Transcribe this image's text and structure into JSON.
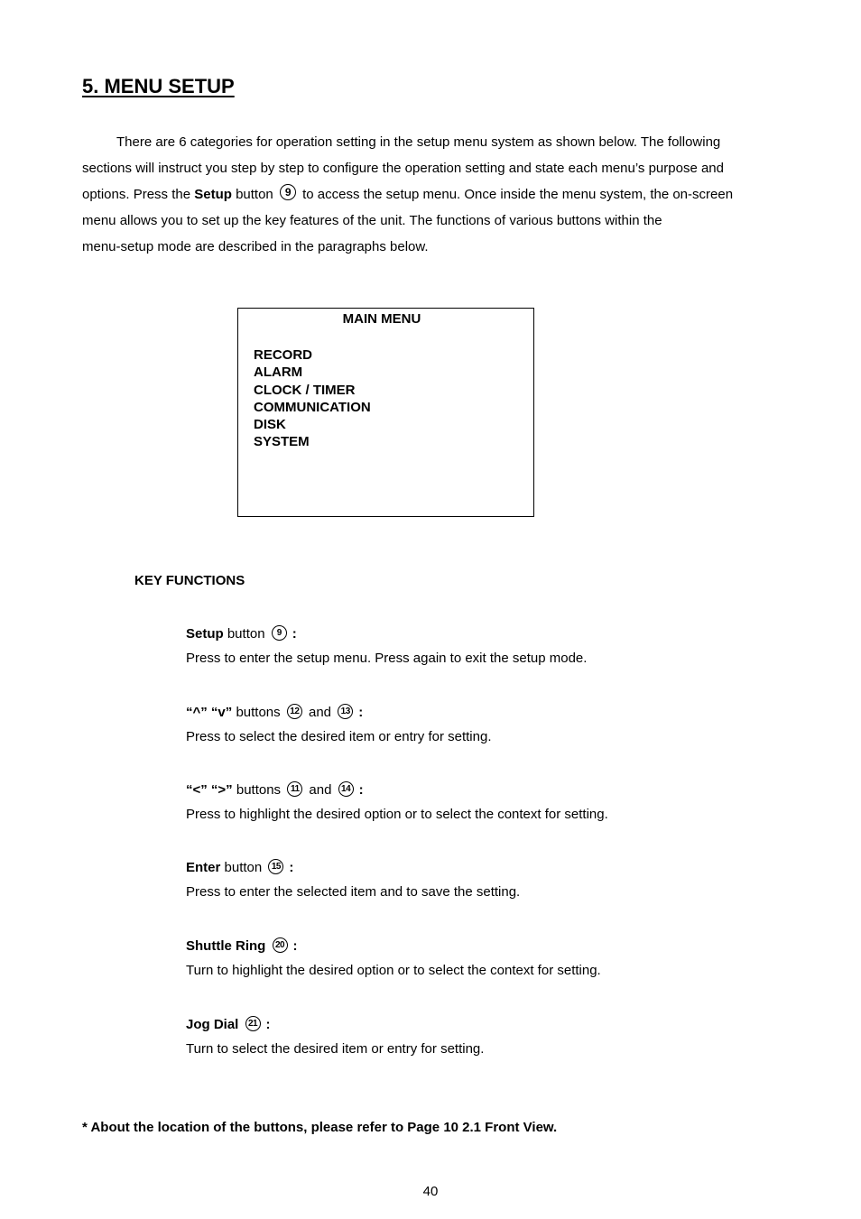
{
  "section_title": "5. MENU SETUP",
  "intro": {
    "line1": "There are 6 categories for operation setting in the setup menu system as shown below. The following",
    "line2": "sections will instruct you step by step to configure the operation setting and state each menu’s purpose and",
    "line3_pre": "options. Press the ",
    "line3_bold": "Setup",
    "line3_mid": " button ",
    "line3_ref": "9",
    "line3_post": " to access the setup menu. Once inside the menu system, the on-screen",
    "line4": "menu allows you to set up the key features of the unit. The functions of various buttons within the",
    "line5": "menu-setup mode are described in the paragraphs below."
  },
  "main_menu": {
    "title": "MAIN MENU",
    "items": [
      "RECORD",
      "ALARM",
      "CLOCK / TIMER",
      "COMMUNICATION",
      "DISK",
      "SYSTEM"
    ]
  },
  "key_functions": {
    "heading": "KEY FUNCTIONS",
    "items": [
      {
        "bold": "Setup",
        "label": " button",
        "refs": [
          "9"
        ],
        "joiner": "",
        "desc": "Press to enter the setup menu. Press again to exit the setup mode."
      },
      {
        "bold": "“^” “v”",
        "label": " buttons",
        "refs": [
          "12",
          "13"
        ],
        "joiner": "and",
        "desc": "Press to select the desired item or entry for setting."
      },
      {
        "bold": "“<” “>”",
        "label": " buttons",
        "refs": [
          "11",
          "14"
        ],
        "joiner": "and",
        "desc": "Press to highlight the desired option or to select the context for setting."
      },
      {
        "bold": "Enter",
        "label": " button",
        "refs": [
          "15"
        ],
        "joiner": "",
        "desc": "Press to enter the selected item and to save the setting."
      },
      {
        "bold": "Shuttle Ring",
        "label": "",
        "refs": [
          "20"
        ],
        "joiner": "",
        "desc": "Turn to highlight the desired option or to select the context for setting."
      },
      {
        "bold": "Jog Dial",
        "label": "",
        "refs": [
          "21"
        ],
        "joiner": "",
        "desc": "Turn to select the desired item or entry for setting."
      }
    ],
    "colon": ":"
  },
  "footnote": "* About the location of the buttons, please refer to Page 10 2.1 Front View.",
  "page_number": "40"
}
